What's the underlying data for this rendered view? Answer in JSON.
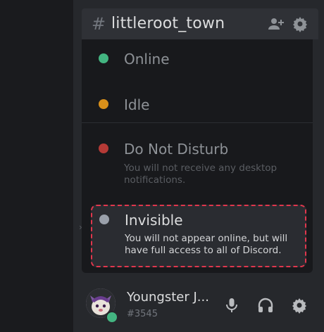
{
  "channel": {
    "hash": "#",
    "name": "littleroot_town"
  },
  "status_menu": {
    "items": [
      {
        "label": "Online",
        "color": "#43b581",
        "description": ""
      },
      {
        "label": "Idle",
        "color": "#faa61a",
        "description": ""
      },
      {
        "label": "Do Not Disturb",
        "color": "#f04747",
        "description": "You will not receive any desktop notifications."
      },
      {
        "label": "Invisible",
        "color": "#9aa0aa",
        "description": "You will not appear online, but will have full access to all of Discord."
      }
    ],
    "highlighted_index": 3
  },
  "user": {
    "name": "Youngster J...",
    "tag": "#3545",
    "status_color": "#43b581"
  },
  "colors": {
    "highlight_border": "#e0374d"
  }
}
